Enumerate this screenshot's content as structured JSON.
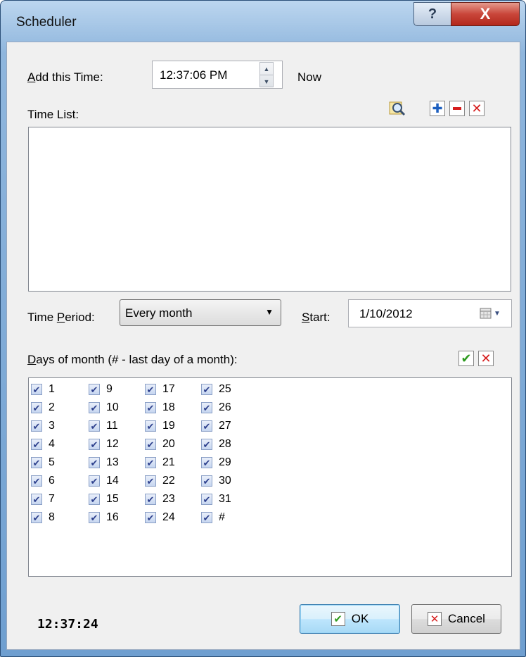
{
  "window": {
    "title": "Scheduler",
    "help_label": "?",
    "close_label": "X"
  },
  "add_time": {
    "label_prefix": "A",
    "label_rest": "dd this Time:",
    "value": "12:37:06 PM",
    "now_label": "Now"
  },
  "time_list": {
    "label": "Time List:",
    "items": []
  },
  "toolbar": {
    "add_icon": "plus-icon",
    "remove_icon": "minus-icon",
    "clear_icon": "x-icon",
    "find_icon": "magnifier-icon"
  },
  "period": {
    "label_a": "Time ",
    "label_u": "P",
    "label_b": "eriod:",
    "selected": "Every month"
  },
  "start": {
    "label_u": "S",
    "label_rest": "tart:",
    "value": "1/10/2012"
  },
  "days": {
    "label_u": "D",
    "label_rest": "ays of month (# - last day of a month):",
    "columns": [
      [
        "1",
        "2",
        "3",
        "4",
        "5",
        "6",
        "7",
        "8"
      ],
      [
        "9",
        "10",
        "11",
        "12",
        "13",
        "14",
        "15",
        "16"
      ],
      [
        "17",
        "18",
        "19",
        "20",
        "21",
        "22",
        "23",
        "24"
      ],
      [
        "25",
        "26",
        "27",
        "28",
        "29",
        "30",
        "31",
        "#"
      ]
    ],
    "all_checked": true
  },
  "footer": {
    "clock": "12:37:24",
    "ok_label": "OK",
    "cancel_label": "Cancel"
  },
  "colors": {
    "check_green": "#2e9b1f",
    "red": "#d61e1e",
    "blue": "#1d5fbf"
  }
}
